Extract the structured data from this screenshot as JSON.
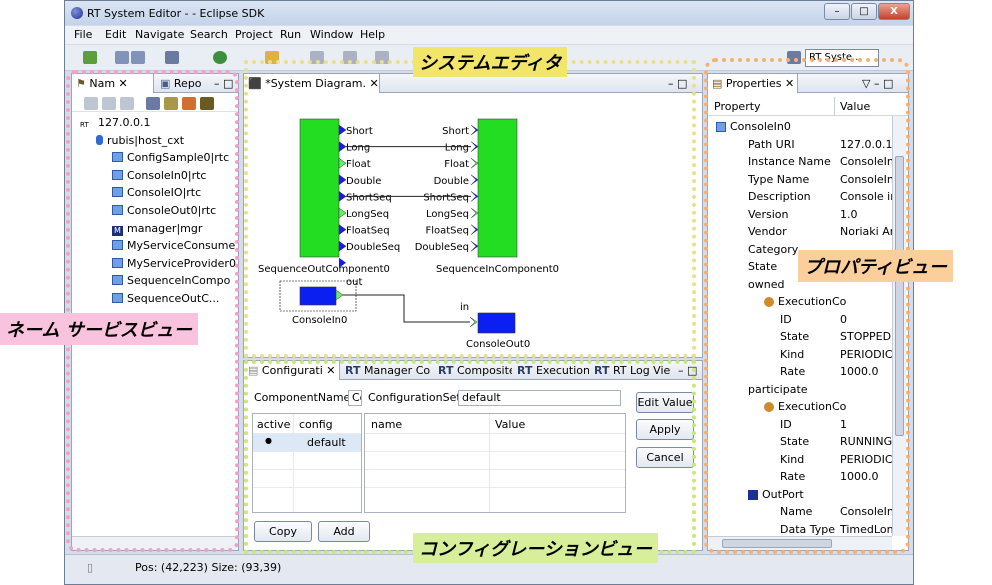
{
  "window": {
    "title": "RT System Editor -  - Eclipse SDK",
    "min": "–",
    "max": "□",
    "close": "X"
  },
  "menu": [
    "File",
    "Edit",
    "Navigate",
    "Search",
    "Project",
    "Run",
    "Window",
    "Help"
  ],
  "perspective": "RT Syste...",
  "name_view": {
    "tabs": [
      "Nam",
      "Repo"
    ],
    "items": [
      {
        "label": "127.0.0.1",
        "icon": "rt-host-icon",
        "indent": 0
      },
      {
        "label": "rubis|host_cxt",
        "icon": "context-icon",
        "indent": 1
      },
      {
        "label": "ConfigSample0|rtc",
        "icon": "rtc-icon",
        "indent": 2
      },
      {
        "label": "ConsoleIn0|rtc",
        "icon": "rtc-icon",
        "indent": 2
      },
      {
        "label": "ConsoleIO|rtc",
        "icon": "rtc-icon",
        "indent": 2
      },
      {
        "label": "ConsoleOut0|rtc",
        "icon": "rtc-icon",
        "indent": 2
      },
      {
        "label": "manager|mgr",
        "icon": "manager-icon",
        "indent": 2
      },
      {
        "label": "MyServiceConsume",
        "icon": "rtc-icon",
        "indent": 2
      },
      {
        "label": "MyServiceProvider0",
        "icon": "rtc-icon",
        "indent": 2
      },
      {
        "label": "SequenceInCompo",
        "icon": "rtc-icon",
        "indent": 2
      },
      {
        "label": "SequenceOutC...",
        "icon": "rtc-icon",
        "indent": 2
      }
    ]
  },
  "diagram": {
    "tab": "*System Diagram.",
    "seq_out": {
      "name": "SequenceOutComponent0",
      "ports": [
        "Short",
        "Long",
        "Float",
        "Double",
        "ShortSeq",
        "LongSeq",
        "FloatSeq",
        "DoubleSeq"
      ]
    },
    "seq_in": {
      "name": "SequenceInComponent0",
      "ports": [
        "Short",
        "Long",
        "Float",
        "Double",
        "ShortSeq",
        "LongSeq",
        "FloatSeq",
        "DoubleSeq"
      ]
    },
    "console_in": {
      "name": "ConsoleIn0",
      "port": "out"
    },
    "console_out": {
      "name": "ConsoleOut0",
      "port": "in"
    }
  },
  "config_view": {
    "tabs": [
      "Configurati",
      "Manager Co",
      "Composite",
      "Execution",
      "RT Log Vie"
    ],
    "component_label": "ComponentName :",
    "component_value": "Co",
    "configset_label": "ConfigurationSet :",
    "configset_value": "default",
    "left_cols": [
      "active",
      "config"
    ],
    "left_rows": [
      {
        "active": "●",
        "config": "default"
      }
    ],
    "right_cols": [
      "name",
      "Value"
    ],
    "buttons": {
      "edit": "Edit Value",
      "apply": "Apply",
      "cancel": "Cancel",
      "copy": "Copy",
      "add": "Add"
    }
  },
  "properties_view": {
    "tab": "Properties",
    "cols": [
      "Property",
      "Value"
    ],
    "rows": [
      {
        "p": "ConsoleIn0",
        "v": "",
        "indent": 0,
        "icon": "rtc-icon"
      },
      {
        "p": "Path URI",
        "v": "127.0.0.1/",
        "indent": 2
      },
      {
        "p": "Instance Name",
        "v": "ConsoleIn",
        "indent": 2
      },
      {
        "p": "Type Name",
        "v": "ConsoleIn",
        "indent": 2
      },
      {
        "p": "Description",
        "v": "Console in",
        "indent": 2
      },
      {
        "p": "Version",
        "v": "1.0",
        "indent": 2
      },
      {
        "p": "Vendor",
        "v": "Noriaki An",
        "indent": 2
      },
      {
        "p": "Category",
        "v": "",
        "indent": 2
      },
      {
        "p": "State",
        "v": "",
        "indent": 2
      },
      {
        "p": "owned",
        "v": "",
        "indent": 2
      },
      {
        "p": "ExecutionCo",
        "v": "",
        "indent": 3,
        "icon": "execution-icon"
      },
      {
        "p": "ID",
        "v": "0",
        "indent": 4
      },
      {
        "p": "State",
        "v": "STOPPED",
        "indent": 4
      },
      {
        "p": "Kind",
        "v": "PERIODIC",
        "indent": 4
      },
      {
        "p": "Rate",
        "v": "1000.0",
        "indent": 4
      },
      {
        "p": "participate",
        "v": "",
        "indent": 2
      },
      {
        "p": "ExecutionCo",
        "v": "",
        "indent": 3,
        "icon": "execution-icon"
      },
      {
        "p": "ID",
        "v": "1",
        "indent": 4
      },
      {
        "p": "State",
        "v": "RUNNING",
        "indent": 4
      },
      {
        "p": "Kind",
        "v": "PERIODIC",
        "indent": 4
      },
      {
        "p": "Rate",
        "v": "1000.0",
        "indent": 4
      },
      {
        "p": "OutPort",
        "v": "",
        "indent": 2,
        "icon": "outport-icon"
      },
      {
        "p": "Name",
        "v": "ConsoleIn",
        "indent": 4
      },
      {
        "p": "Data Type",
        "v": "TimedLon",
        "indent": 4
      }
    ]
  },
  "status": {
    "text": "Pos: (42,223) Size: (93,39)"
  },
  "callouts": {
    "system_editor": "システムエディタ",
    "name_service": "ネーム サービスビュー",
    "properties": "プロパティビュー",
    "configuration": "コンフィグレーションビュー"
  },
  "colors": {
    "component": "#22dd22",
    "console": "#0a1ff0",
    "callout_yellow": "#e8d84a",
    "callout_pink": "#f4a0c8",
    "callout_orange": "#f7b070",
    "callout_green": "#c8e87a"
  }
}
